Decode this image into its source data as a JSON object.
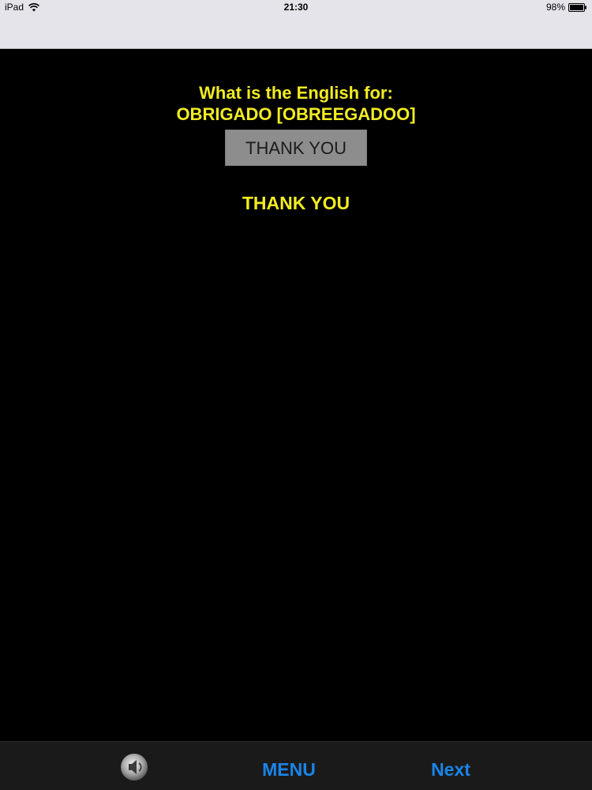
{
  "status_bar": {
    "device": "iPad",
    "time": "21:30",
    "battery": "98%"
  },
  "quiz": {
    "prompt": "What is the English for:",
    "word": "OBRIGADO [OBREEGADOO]",
    "answer_box": "THANK YOU",
    "feedback": "THANK YOU"
  },
  "toolbar": {
    "speaker_icon": "speaker-icon",
    "menu_label": "MENU",
    "next_label": "Next"
  },
  "colors": {
    "prompt_text": "#f2ec22",
    "toolbar_link": "#1a84e8",
    "background": "#000000"
  }
}
